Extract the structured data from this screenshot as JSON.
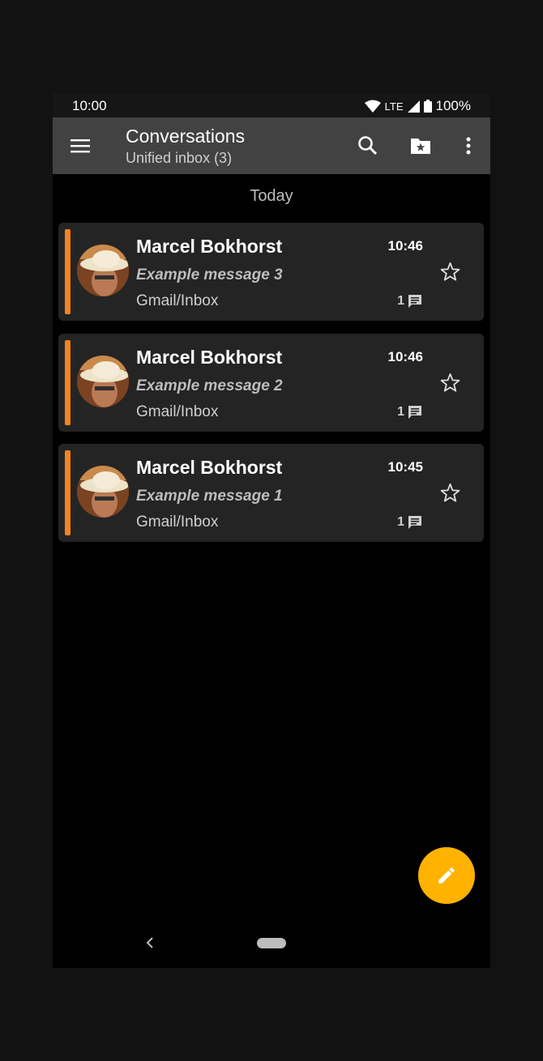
{
  "status_bar": {
    "time": "10:00",
    "network": "LTE",
    "battery": "100%",
    "icons": [
      "wifi-icon",
      "signal-icon",
      "battery-icon"
    ]
  },
  "toolbar": {
    "title": "Conversations",
    "subtitle": "Unified inbox (3)",
    "icons": [
      "menu-icon",
      "search-icon",
      "folder-star-icon",
      "more-vert-icon"
    ]
  },
  "day_header": "Today",
  "messages": [
    {
      "sender": "Marcel Bokhorst",
      "time": "10:46",
      "subject": "Example message 3",
      "folder": "Gmail/Inbox",
      "count": "1"
    },
    {
      "sender": "Marcel Bokhorst",
      "time": "10:46",
      "subject": "Example message 2",
      "folder": "Gmail/Inbox",
      "count": "1"
    },
    {
      "sender": "Marcel Bokhorst",
      "time": "10:45",
      "subject": "Example message 1",
      "folder": "Gmail/Inbox",
      "count": "1"
    }
  ],
  "colors": {
    "accent": "#f5841f",
    "fab": "#ffb300",
    "toolbar": "#424242",
    "card": "#242424"
  },
  "fab_icon": "pencil-icon"
}
